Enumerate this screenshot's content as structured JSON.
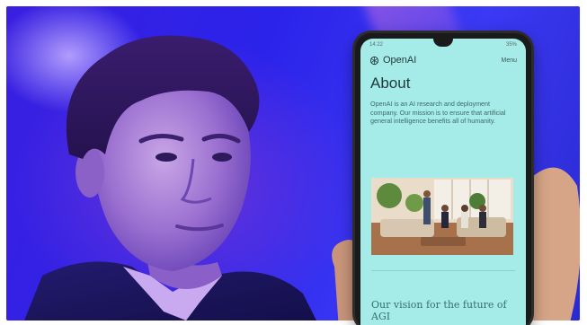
{
  "phone": {
    "status_time": "14:22",
    "status_right": "35%",
    "brand": "OpenAI",
    "menu_label": "Menu",
    "about_title": "About",
    "about_text": "OpenAI is an AI research and deployment company. Our mission is to ensure that artificial general intelligence benefits all of humanity.",
    "vision_heading": "Our vision for the future of AGI"
  },
  "colors": {
    "background_blue": "#2b23ea",
    "screen_teal": "#a5ebe7"
  },
  "icons": [
    "openai-logo-icon"
  ]
}
